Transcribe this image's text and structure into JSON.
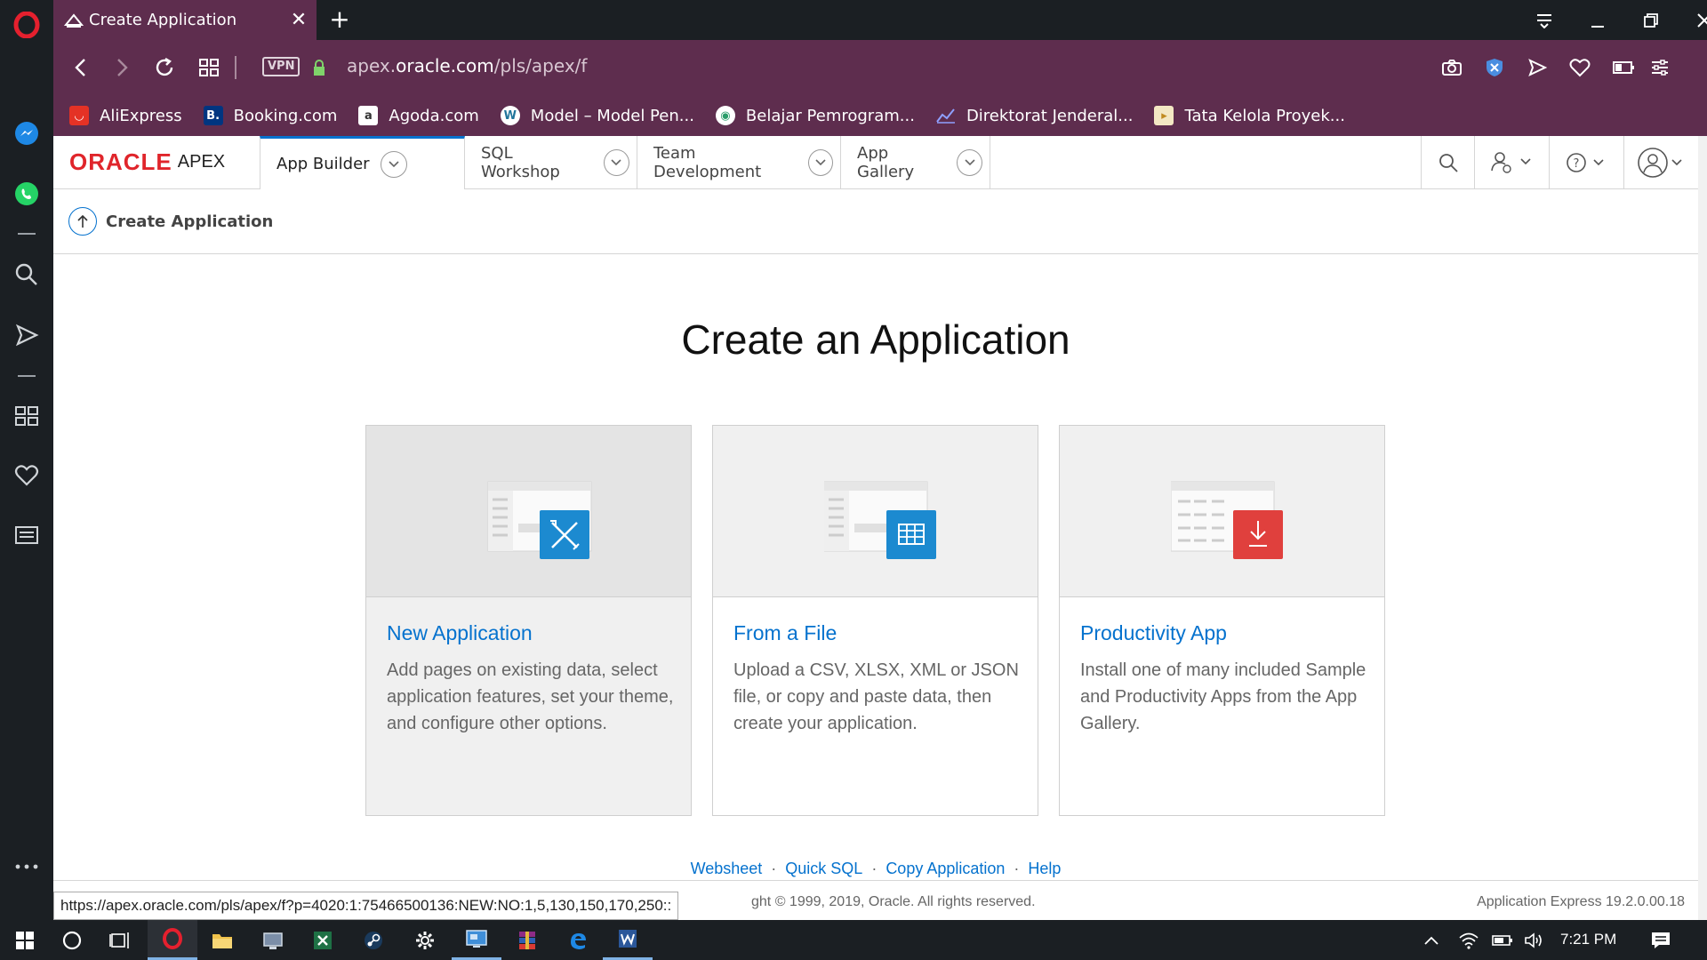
{
  "browser": {
    "tab_title": "Create Application",
    "url_prefix": "apex.",
    "url_domain": "oracle.com",
    "url_path": "/pls/apex/f",
    "vpn_label": "VPN",
    "status_url": "https://apex.oracle.com/pls/apex/f?p=4020:1:75466500136:NEW:NO:1,5,130,150,170,250::"
  },
  "bookmarks": [
    {
      "label": "AliExpress",
      "icon": "aliexpress-icon",
      "color": "#e43225"
    },
    {
      "label": "Booking.com",
      "icon": "booking-icon",
      "color": "#003580"
    },
    {
      "label": "Agoda.com",
      "icon": "agoda-icon",
      "color": "#ffffff"
    },
    {
      "label": "Model – Model Pen...",
      "icon": "wordpress-icon",
      "color": "#21759b"
    },
    {
      "label": "Belajar Pemrogram...",
      "icon": "globe-icon",
      "color": "#2a9d6a"
    },
    {
      "label": "Direktorat Jenderal...",
      "icon": "chart-icon",
      "color": "#4a5fb0"
    },
    {
      "label": "Tata Kelola Proyek...",
      "icon": "folder-icon",
      "color": "#e8c04a"
    }
  ],
  "apex": {
    "logo_oracle": "ORACLE",
    "logo_apex": "APEX",
    "nav": [
      "App Builder",
      "SQL Workshop",
      "Team Development",
      "App Gallery"
    ],
    "breadcrumb": "Create Application"
  },
  "main": {
    "title": "Create an Application",
    "cards": [
      {
        "title": "New Application",
        "desc": "Add pages on existing data, select application features, set your theme, and configure other options.",
        "accent": "#1c8ad0"
      },
      {
        "title": "From a File",
        "desc": "Upload a CSV, XLSX, XML or JSON file, or copy and paste data, then create your application.",
        "accent": "#1c8ad0"
      },
      {
        "title": "Productivity App",
        "desc": "Install one of many included Sample and Productivity Apps from the App Gallery.",
        "accent": "#e0403d"
      }
    ]
  },
  "footer": {
    "links": [
      "Websheet",
      "Quick SQL",
      "Copy Application",
      "Help"
    ],
    "copyright": "ght © 1999, 2019, Oracle. All rights reserved.",
    "version": "Application Express 19.2.0.00.18"
  },
  "taskbar": {
    "clock": "7:21 PM"
  },
  "colors": {
    "browser_accent": "#5e2d4e",
    "apex_blue": "#0572ce",
    "oracle_red": "#e0252b"
  }
}
